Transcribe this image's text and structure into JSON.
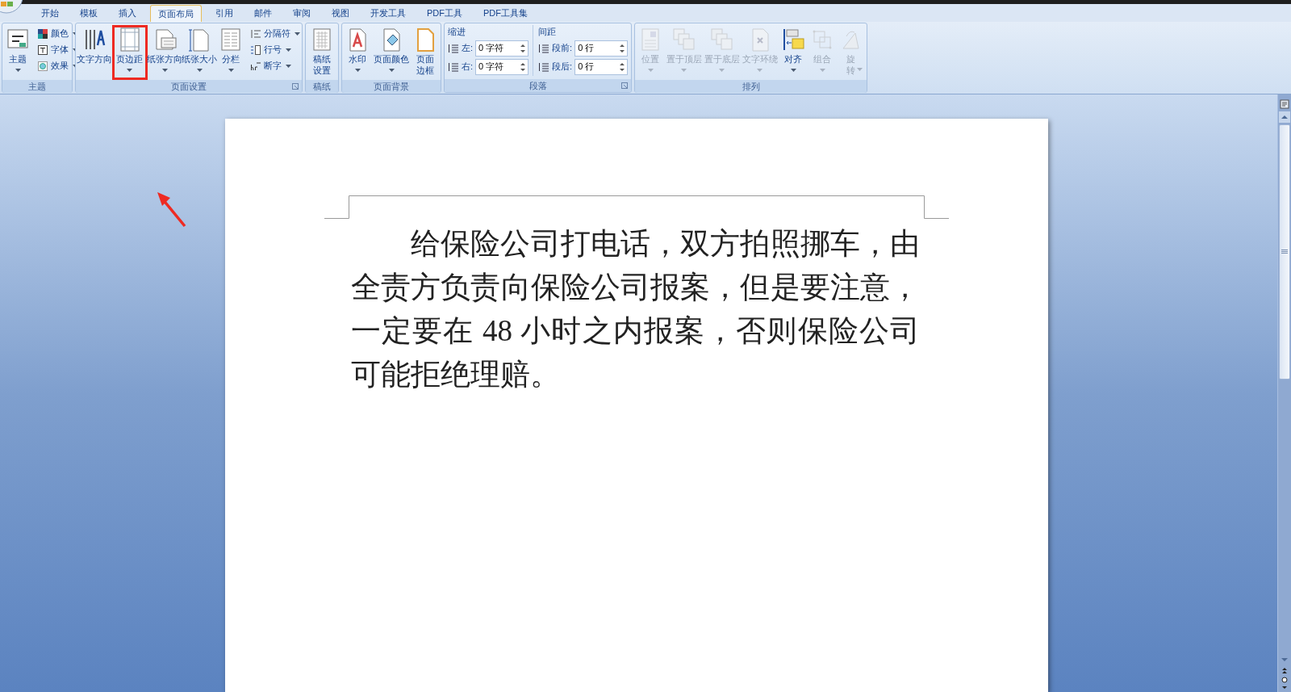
{
  "tabs": [
    {
      "label": "开始",
      "selected": false
    },
    {
      "label": "模板",
      "selected": false
    },
    {
      "label": "插入",
      "selected": false
    },
    {
      "label": "页面布局",
      "selected": true
    },
    {
      "label": "引用",
      "selected": false
    },
    {
      "label": "邮件",
      "selected": false
    },
    {
      "label": "审阅",
      "selected": false
    },
    {
      "label": "视图",
      "selected": false
    },
    {
      "label": "开发工具",
      "selected": false
    },
    {
      "label": "PDF工具",
      "selected": false
    },
    {
      "label": "PDF工具集",
      "selected": false
    }
  ],
  "ribbon_groups": [
    {
      "label": "主题",
      "dialog_launcher": false,
      "items": [
        {
          "kind": "large",
          "label": "主题",
          "dropdown": true,
          "disabled": false,
          "highlighted": false
        },
        {
          "kind": "stack",
          "buttons": [
            {
              "label": "颜色",
              "dropdown": true
            },
            {
              "label": "字体",
              "dropdown": true
            },
            {
              "label": "效果",
              "dropdown": true
            }
          ]
        }
      ]
    },
    {
      "label": "页面设置",
      "dialog_launcher": true,
      "items": [
        {
          "kind": "large",
          "label": "文字方向",
          "dropdown": false,
          "disabled": false,
          "highlighted": false
        },
        {
          "kind": "large",
          "label": "页边距",
          "dropdown": true,
          "disabled": false,
          "highlighted": true
        },
        {
          "kind": "large",
          "label": "纸张方向",
          "dropdown": true,
          "disabled": false,
          "highlighted": false
        },
        {
          "kind": "large",
          "label": "纸张大小",
          "dropdown": true,
          "disabled": false,
          "highlighted": false
        },
        {
          "kind": "large",
          "label": "分栏",
          "dropdown": true,
          "disabled": false,
          "highlighted": false
        },
        {
          "kind": "stack",
          "buttons": [
            {
              "label": "分隔符",
              "dropdown": true
            },
            {
              "label": "行号",
              "dropdown": true
            },
            {
              "label": "断字",
              "dropdown": true
            }
          ]
        }
      ]
    },
    {
      "label": "稿纸",
      "dialog_launcher": false,
      "items": [
        {
          "kind": "large",
          "label": "稿纸设置",
          "dropdown": false,
          "disabled": false,
          "highlighted": false
        }
      ]
    },
    {
      "label": "页面背景",
      "dialog_launcher": false,
      "items": [
        {
          "kind": "large",
          "label": "水印",
          "dropdown": true,
          "disabled": false,
          "highlighted": false
        },
        {
          "kind": "large",
          "label": "页面颜色",
          "dropdown": true,
          "disabled": false,
          "highlighted": false
        },
        {
          "kind": "large",
          "label": "页面边框",
          "dropdown": false,
          "disabled": false,
          "highlighted": false
        }
      ]
    },
    {
      "label": "段落",
      "dialog_launcher": true,
      "items": [
        {
          "kind": "fields",
          "title": "缩进",
          "fields": [
            {
              "label": "左:",
              "value": "0 字符"
            },
            {
              "label": "右:",
              "value": "0 字符"
            }
          ]
        },
        {
          "kind": "fields",
          "title": "间距",
          "fields": [
            {
              "label": "段前:",
              "value": "0 行"
            },
            {
              "label": "段后:",
              "value": "0 行"
            }
          ]
        }
      ]
    },
    {
      "label": "排列",
      "dialog_launcher": false,
      "items": [
        {
          "kind": "large",
          "label": "位置",
          "dropdown": true,
          "disabled": true,
          "highlighted": false
        },
        {
          "kind": "large",
          "label": "置于顶层",
          "dropdown": true,
          "disabled": true,
          "highlighted": false
        },
        {
          "kind": "large",
          "label": "置于底层",
          "dropdown": true,
          "disabled": true,
          "highlighted": false
        },
        {
          "kind": "large",
          "label": "文字环绕",
          "dropdown": true,
          "disabled": true,
          "highlighted": false
        },
        {
          "kind": "large",
          "label": "对齐",
          "dropdown": true,
          "disabled": false,
          "highlighted": false
        },
        {
          "kind": "large",
          "label": "组合",
          "dropdown": true,
          "disabled": true,
          "highlighted": false
        },
        {
          "kind": "large",
          "label": "旋转",
          "dropdown": true,
          "disabled": true,
          "highlighted": false
        }
      ]
    }
  ],
  "document": {
    "paragraph": "给保险公司打电话，双方拍照挪车，由全责方负责向保险公司报案，但是要注意，一定要在 48 小时之内报案，否则保险公司可能拒绝理赔。"
  }
}
